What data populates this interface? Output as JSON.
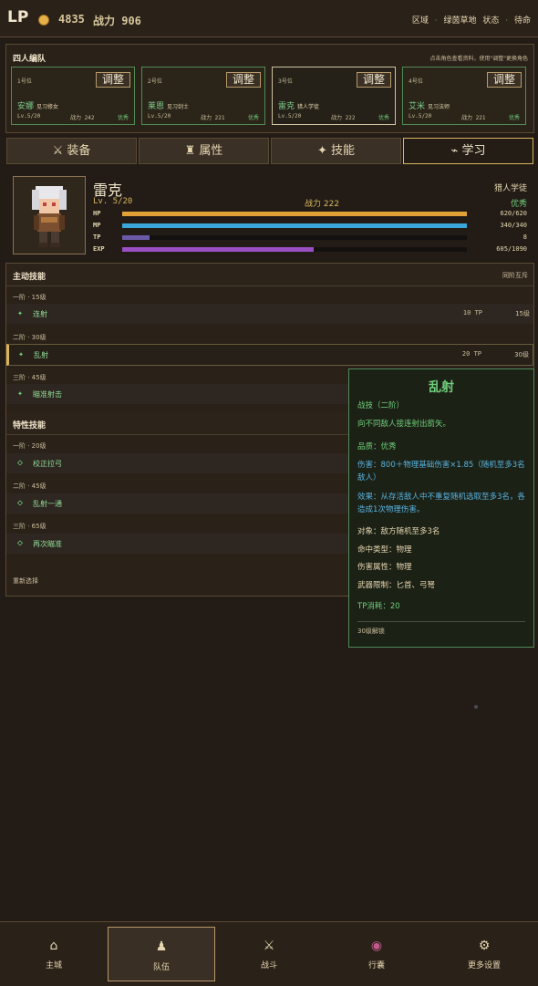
{
  "header": {
    "lp": "LP",
    "gold": "4835",
    "power_label": "战力 906",
    "nav": [
      "区域",
      "·",
      "绿茵草地",
      "状态",
      "·",
      "待命"
    ]
  },
  "team": {
    "title": "四人编队",
    "hint": "点击角色查看资料，使用\"调整\"更换角色",
    "adjust_label": "调整",
    "slots": [
      {
        "pos": "1号位",
        "name": "安娜",
        "cls": "见习修女",
        "lv": "Lv.5/20",
        "power": "战力 242",
        "quality": "优秀"
      },
      {
        "pos": "2号位",
        "name": "莱恩",
        "cls": "见习剑士",
        "lv": "Lv.5/20",
        "power": "战力 221",
        "quality": "优秀"
      },
      {
        "pos": "3号位",
        "name": "雷克",
        "cls": "猎人学徒",
        "lv": "Lv.5/20",
        "power": "战力 222",
        "quality": "优秀"
      },
      {
        "pos": "4号位",
        "name": "艾米",
        "cls": "见习法师",
        "lv": "Lv.5/20",
        "power": "战力 221",
        "quality": "优秀"
      }
    ]
  },
  "tabs": [
    {
      "icon": "⚔",
      "label": "装备"
    },
    {
      "icon": "♜",
      "label": "属性"
    },
    {
      "icon": "✦",
      "label": "技能"
    },
    {
      "icon": "⌁",
      "label": "学习"
    }
  ],
  "hero": {
    "name": "雷克",
    "level": "Lv. 5/20",
    "power": "战力 222",
    "class": "猎人学徒",
    "quality": "优秀",
    "bars": [
      {
        "label": "HP",
        "value": "620/620",
        "fraction": 1.0,
        "color": "#e0a238"
      },
      {
        "label": "MP",
        "value": "340/340",
        "fraction": 1.0,
        "color": "#3aa6d9"
      },
      {
        "label": "TP",
        "value": "8",
        "fraction": 0.08,
        "color": "#6a5aa8"
      },
      {
        "label": "EXP",
        "value": "605/1090",
        "fraction": 0.555,
        "color": "#9a4fc4"
      }
    ]
  },
  "skills": {
    "active_title": "主动技能",
    "active_right": "同阶互斥",
    "tier1": "一阶 · 15级",
    "tier2": "二阶 · 30级",
    "tier3": "三阶 · 45级",
    "active": [
      {
        "icon": "✦",
        "name": "连射",
        "tp": "10 TP",
        "lv": "15级"
      },
      {
        "icon": "✦",
        "name": "乱射",
        "tp": "20 TP",
        "lv": "30级"
      },
      {
        "icon": "✦",
        "name": "瞄准射击",
        "tp": "",
        "lv": ""
      }
    ],
    "trait_title": "特性技能",
    "ttier1": "一阶 · 20级",
    "ttier2": "二阶 · 45级",
    "ttier3": "三阶 · 65级",
    "traits": [
      {
        "icon": "◇",
        "name": "校正拉弓"
      },
      {
        "icon": "◇",
        "name": "乱射一通"
      },
      {
        "icon": "◇",
        "name": "再次瞄准"
      }
    ],
    "reselect": "重新选择"
  },
  "tooltip": {
    "title": "乱射",
    "type": "战技（二阶）",
    "desc": "向不同敌人接连射出箭矢。",
    "quality": "品质：优秀",
    "damage": "伤害：800＋物理基础伤害×1.85（随机至多3名敌人）",
    "effect": "效果：从存活敌人中不重复随机选取至多3名，各造成1次物理伤害。",
    "target": "对象：敌方随机至多3名",
    "hit": "命中类型：物理",
    "attr": "伤害属性：物理",
    "weapon": "武器限制：匕首、弓弩",
    "tp": "TP消耗：20",
    "unlock": "30级解锁"
  },
  "bottom_nav": [
    {
      "icon": "⌂",
      "label": "主城"
    },
    {
      "icon": "♟",
      "label": "队伍"
    },
    {
      "icon": "⚔",
      "label": "战斗"
    },
    {
      "icon": "◉",
      "label": "行囊"
    },
    {
      "icon": "⚙",
      "label": "更多设置"
    }
  ]
}
